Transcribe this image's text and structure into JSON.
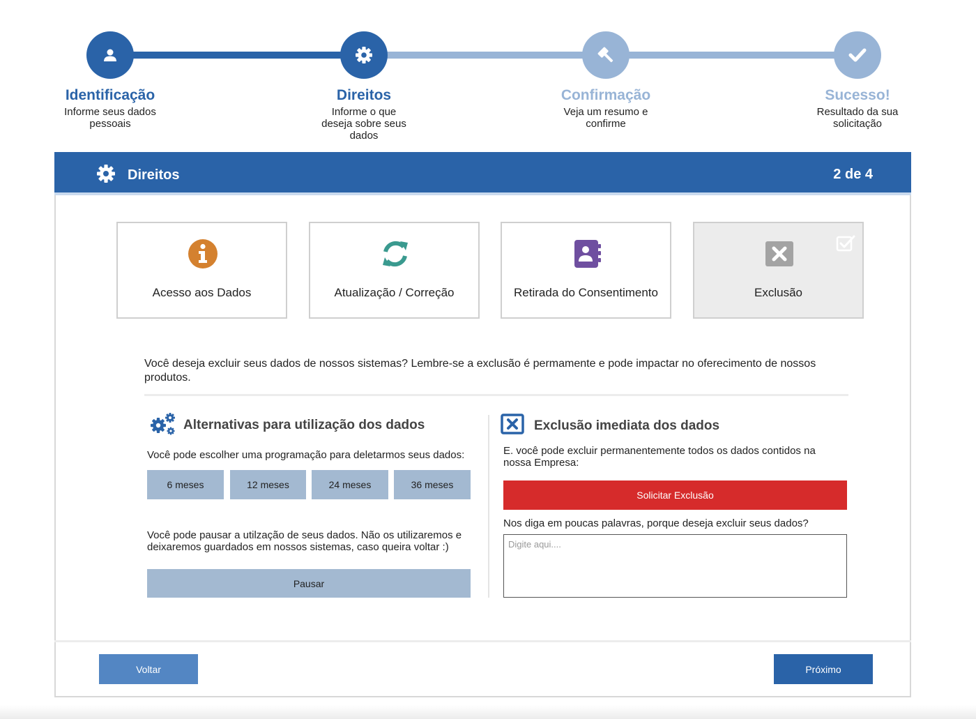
{
  "stepper": {
    "steps": [
      {
        "title": "Identificação",
        "desc": "Informe seus dados pessoais",
        "icon": "user-icon",
        "state": "active"
      },
      {
        "title": "Direitos",
        "desc": "Informe o que deseja sobre seus dados",
        "icon": "gear-icon",
        "state": "active"
      },
      {
        "title": "Confirmação",
        "desc": "Veja um resumo e confirme",
        "icon": "gavel-icon",
        "state": "inactive"
      },
      {
        "title": "Sucesso!",
        "desc": "Resultado da sua solicitação",
        "icon": "check-icon",
        "state": "inactive"
      }
    ]
  },
  "header": {
    "title": "Direitos",
    "count": "2 de 4",
    "icon": "gear-icon"
  },
  "options": [
    {
      "label": "Acesso aos Dados",
      "icon": "info-icon",
      "color": "#d4812f"
    },
    {
      "label": "Atualização / Correção",
      "icon": "refresh-icon",
      "color": "#3a9a8f"
    },
    {
      "label": "Retirada do Consentimento",
      "icon": "address-book-icon",
      "color": "#6f4fa0"
    },
    {
      "label": "Exclusão",
      "icon": "close-box-icon",
      "color": "#a3a3a3",
      "selected": true
    }
  ],
  "intro": "Você deseja excluir seus dados de nossos sistemas? Lembre-se a exclusão é permamente e pode impactar no oferecimento de nossos produtos.",
  "alternatives": {
    "title": "Alternativas para utilização dos dados",
    "schedule_text": "Você pode escolher uma programação para deletarmos seus dados:",
    "schedule_options": [
      "6 meses",
      "12 meses",
      "24 meses",
      "36 meses"
    ],
    "pause_text": "Você pode pausar a utilzação de seus dados. Não os utilizaremos e deixaremos guardados em nossos sistemas, caso queira voltar :)",
    "pause_label": "Pausar"
  },
  "deletion": {
    "title": "Exclusão imediata dos dados",
    "text": "E. você pode excluir permanentemente todos os dados contidos na nossa Empresa:",
    "request_label": "Solicitar Exclusão",
    "reason_label": "Nos diga em poucas palavras, porque deseja excluir seus dados?",
    "reason_placeholder": "Digite aqui...."
  },
  "footer": {
    "back_label": "Voltar",
    "next_label": "Próximo"
  },
  "colors": {
    "primary": "#2a63a8",
    "inactive": "#98b4d6",
    "danger": "#d62b2b",
    "muted_button": "#a3b9d1"
  }
}
